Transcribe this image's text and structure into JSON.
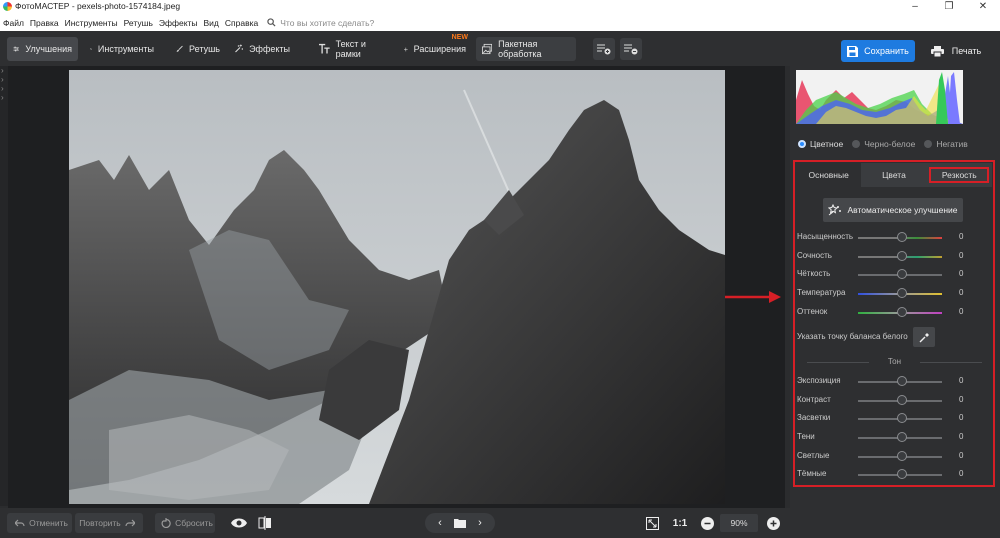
{
  "window": {
    "title": "ФотоМАСТЕР - pexels-photo-1574184.jpeg"
  },
  "menu": {
    "items": [
      "Файл",
      "Правка",
      "Инструменты",
      "Ретушь",
      "Эффекты",
      "Вид",
      "Справка"
    ],
    "search_placeholder": "Что вы хотите сделать?"
  },
  "toolbar": {
    "tabs": [
      {
        "label": "Улучшения",
        "icon": "sliders-icon"
      },
      {
        "label": "Инструменты",
        "icon": "crop-icon"
      },
      {
        "label": "Ретушь",
        "icon": "brush-icon"
      },
      {
        "label": "Эффекты",
        "icon": "magic-wand-icon"
      },
      {
        "label": "Текст и рамки",
        "icon": "text-icon"
      },
      {
        "label": "Расширения",
        "icon": "plus-icon",
        "badge": "NEW"
      }
    ],
    "batch_label": "Пакетная обработка",
    "save_label": "Сохранить",
    "print_label": "Печать",
    "accent": "#1e7be0"
  },
  "bottom": {
    "undo_label": "Отменить",
    "redo_label": "Повторить",
    "reset_label": "Сбросить",
    "ratio_label": "1:1",
    "zoom": "90%"
  },
  "panel": {
    "modes": [
      {
        "label": "Цветное",
        "selected": true
      },
      {
        "label": "Черно-белое",
        "selected": false
      },
      {
        "label": "Негатив",
        "selected": false
      }
    ],
    "tabs": [
      "Основные",
      "Цвета",
      "Резкость"
    ],
    "auto_label": "Автоматическое улучшение",
    "sliders": [
      {
        "label": "Насыщенность",
        "value": "0"
      },
      {
        "label": "Сочность",
        "value": "0"
      },
      {
        "label": "Чёткость",
        "value": "0"
      },
      {
        "label": "Температура",
        "value": "0"
      },
      {
        "label": "Оттенок",
        "value": "0"
      }
    ],
    "white_balance_label": "Указать точку баланса белого",
    "tone_title": "Тон",
    "tone_sliders": [
      {
        "label": "Экспозиция",
        "value": "0"
      },
      {
        "label": "Контраст",
        "value": "0"
      },
      {
        "label": "Засветки",
        "value": "0"
      },
      {
        "label": "Тени",
        "value": "0"
      },
      {
        "label": "Светлые",
        "value": "0"
      },
      {
        "label": "Тёмные",
        "value": "0"
      }
    ],
    "highlight_color": "#d61f26"
  }
}
